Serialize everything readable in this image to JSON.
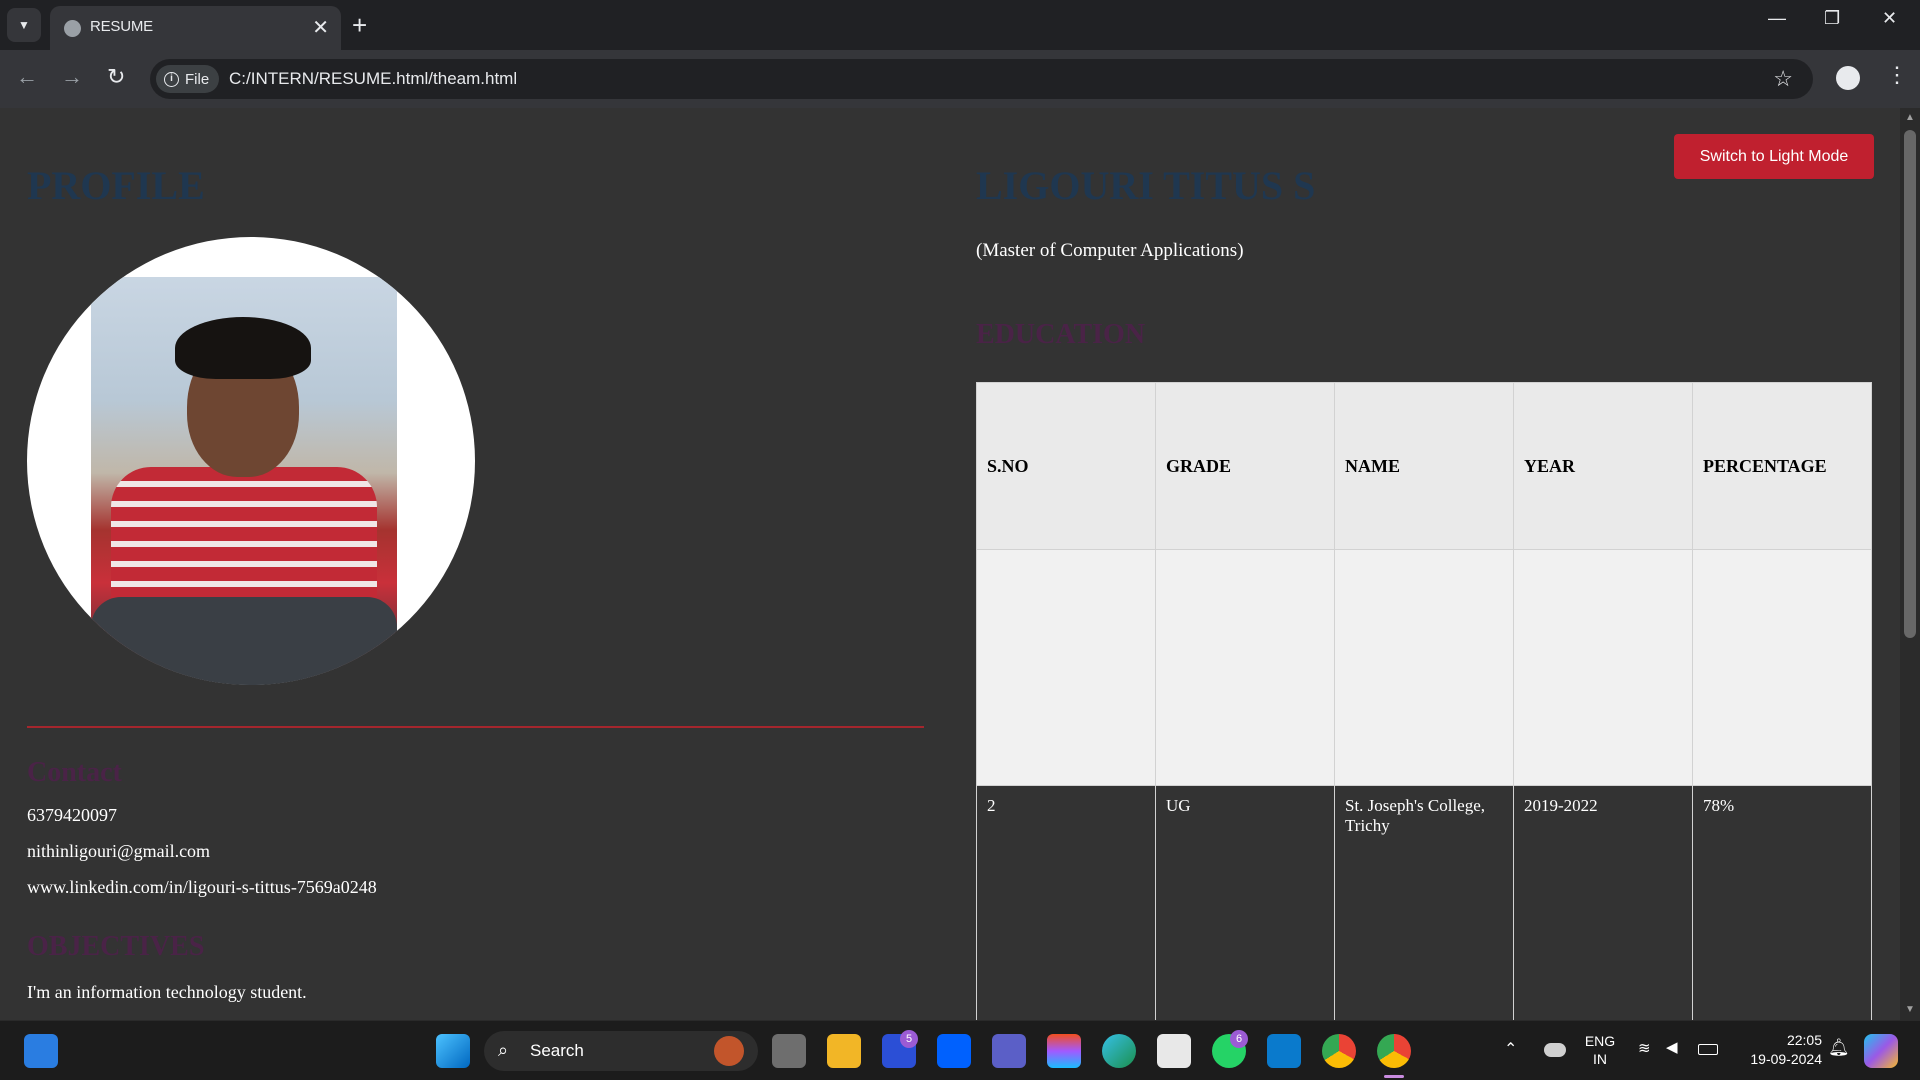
{
  "browser": {
    "tab_title": "RESUME",
    "tab_close": "✕",
    "new_tab": "+",
    "site_chip": "File",
    "url": "C:/INTERN/RESUME.html/theam.html",
    "window_controls": {
      "minimize": "—",
      "restore": "❐",
      "close": "✕"
    },
    "nav": {
      "back": "←",
      "forward": "→",
      "reload": "↻",
      "star": "☆",
      "menu": "⋮"
    }
  },
  "page": {
    "theme_toggle_label": "Switch to Light Mode",
    "profile_heading": "PROFILE",
    "name_heading": "LIGOURI TITUS S",
    "degree": "(Master of Computer Applications)",
    "contact": {
      "heading": "Contact",
      "phone": "6379420097",
      "email": "nithinligouri@gmail.com",
      "linkedin": "www.linkedin.com/in/ligouri-s-tittus-7569a0248"
    },
    "objectives": {
      "heading": "OBJECTIVES",
      "text": "I'm an information technology student."
    },
    "education": {
      "heading": "EDUCATION",
      "columns": [
        "S.NO",
        "GRADE",
        "NAME",
        "YEAR",
        "PERCENTAGE"
      ],
      "rows": [
        [
          "",
          "",
          "",
          "",
          ""
        ],
        [
          "2",
          "UG",
          "St. Joseph's College, Trichy",
          "2019-2022",
          "78%"
        ]
      ]
    }
  },
  "taskbar": {
    "search_label": "Search",
    "badges": {
      "teams_l": "5",
      "whatsapp": "6"
    },
    "language": {
      "line1": "ENG",
      "line2": "IN"
    },
    "clock": {
      "time": "22:05",
      "date": "19-09-2024"
    }
  },
  "colors": {
    "accent_red": "#c0202f",
    "heading_blue": "#1f3750",
    "heading_purple": "#4a2347",
    "page_bg": "#333333"
  }
}
